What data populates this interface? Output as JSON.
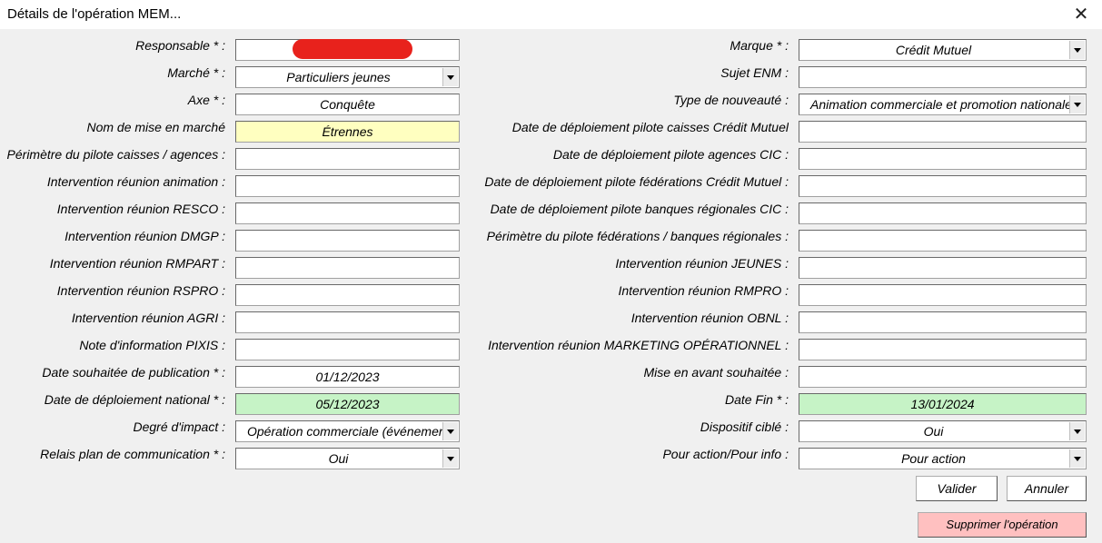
{
  "window": {
    "title": "Détails de l'opération MEM..."
  },
  "left": [
    {
      "label": "Responsable * :",
      "value": "",
      "type": "text",
      "bg": "white"
    },
    {
      "label": "Marché * :",
      "value": "Particuliers jeunes",
      "type": "combo",
      "bg": "white"
    },
    {
      "label": "Axe * :",
      "value": "Conquête",
      "type": "text",
      "bg": "white"
    },
    {
      "label": "Nom de mise en marché",
      "value": "Étrennes",
      "type": "text",
      "bg": "yellow"
    },
    {
      "label": "Périmètre du pilote caisses / agences :",
      "value": "",
      "type": "text",
      "bg": "white"
    },
    {
      "label": "Intervention réunion animation :",
      "value": "",
      "type": "text",
      "bg": "white"
    },
    {
      "label": "Intervention réunion RESCO :",
      "value": "",
      "type": "text",
      "bg": "white"
    },
    {
      "label": "Intervention réunion DMGP :",
      "value": "",
      "type": "text",
      "bg": "white"
    },
    {
      "label": "Intervention réunion RMPART :",
      "value": "",
      "type": "text",
      "bg": "white"
    },
    {
      "label": "Intervention réunion RSPRO :",
      "value": "",
      "type": "text",
      "bg": "white"
    },
    {
      "label": "Intervention réunion AGRI :",
      "value": "",
      "type": "text",
      "bg": "white"
    },
    {
      "label": "Note d'information PIXIS :",
      "value": "",
      "type": "text",
      "bg": "white"
    },
    {
      "label": "Date souhaitée de publication * :",
      "value": "01/12/2023",
      "type": "text",
      "bg": "white"
    },
    {
      "label": "Date de déploiement national * :",
      "value": "05/12/2023",
      "type": "text",
      "bg": "green"
    },
    {
      "label": "Degré d'impact :",
      "value": "Opération commerciale (événement)",
      "type": "combo",
      "bg": "white",
      "align": "left"
    },
    {
      "label": "Relais plan de communication * :",
      "value": "Oui",
      "type": "combo",
      "bg": "white"
    }
  ],
  "right": [
    {
      "label": "Marque * :",
      "value": "Crédit Mutuel",
      "type": "combo",
      "bg": "white"
    },
    {
      "label": "Sujet ENM :",
      "value": "",
      "type": "text",
      "bg": "white"
    },
    {
      "label": "Type de nouveauté :",
      "value": "Animation commerciale et promotion nationale",
      "type": "combo",
      "bg": "white",
      "align": "left"
    },
    {
      "label": "Date de déploiement pilote caisses Crédit Mutuel",
      "value": "",
      "type": "text",
      "bg": "white"
    },
    {
      "label": "Date de déploiement pilote agences CIC :",
      "value": "",
      "type": "text",
      "bg": "white"
    },
    {
      "label": "Date de déploiement pilote fédérations Crédit Mutuel :",
      "value": "",
      "type": "text",
      "bg": "white"
    },
    {
      "label": "Date de déploiement pilote banques régionales CIC :",
      "value": "",
      "type": "text",
      "bg": "white"
    },
    {
      "label": "Périmètre du pilote fédérations / banques régionales :",
      "value": "",
      "type": "text",
      "bg": "white"
    },
    {
      "label": "Intervention réunion JEUNES :",
      "value": "",
      "type": "text",
      "bg": "white"
    },
    {
      "label": "Intervention réunion RMPRO :",
      "value": "",
      "type": "text",
      "bg": "white"
    },
    {
      "label": "Intervention réunion OBNL :",
      "value": "",
      "type": "text",
      "bg": "white"
    },
    {
      "label": "Intervention réunion MARKETING OPÉRATIONNEL :",
      "value": "",
      "type": "text",
      "bg": "white"
    },
    {
      "label": "Mise en avant souhaitée :",
      "value": "",
      "type": "text",
      "bg": "white"
    },
    {
      "label": "Date Fin * :",
      "value": "13/01/2024",
      "type": "text",
      "bg": "green"
    },
    {
      "label": "Dispositif ciblé :",
      "value": "Oui",
      "type": "combo",
      "bg": "white"
    },
    {
      "label": "Pour action/Pour info :",
      "value": "Pour action",
      "type": "combo",
      "bg": "white"
    }
  ],
  "buttons": {
    "validate": "Valider",
    "cancel": "Annuler",
    "delete": "Supprimer l'opération"
  },
  "icons": {
    "close": "close-icon",
    "dropdown": "chevron-down-icon"
  },
  "colors": {
    "highlight_yellow": "#ffffc0",
    "highlight_green": "#c6f3c6",
    "delete_button": "#ffc0c0",
    "redaction": "#e8221c",
    "form_background": "#f0f0f0"
  }
}
